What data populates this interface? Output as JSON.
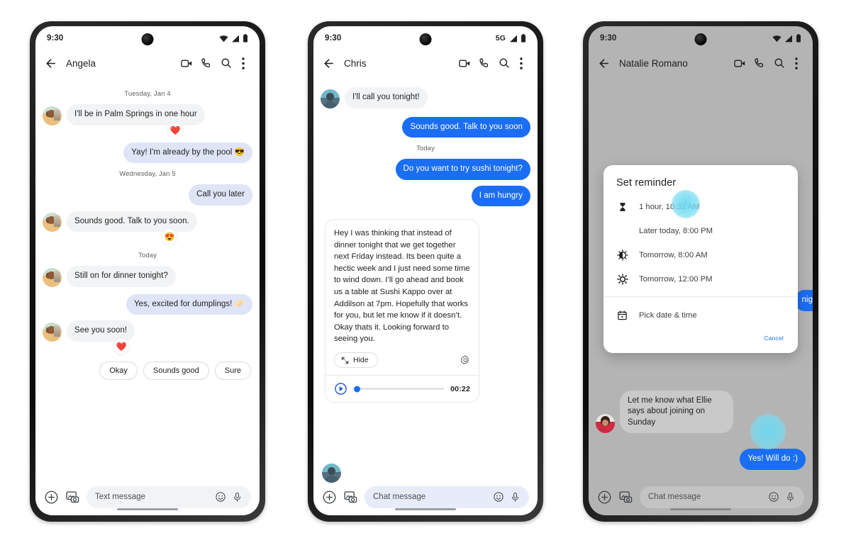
{
  "phones": [
    {
      "id": "phone-sms",
      "status": {
        "time": "9:30",
        "network": "",
        "icons": [
          "wifi-icon",
          "signal-icon",
          "battery-icon"
        ]
      },
      "appbar": {
        "back": "back-arrow-icon",
        "title": "Angela",
        "actions": [
          "video-call-icon",
          "phone-call-icon",
          "search-icon",
          "overflow-menu-icon"
        ]
      },
      "messages": [
        {
          "kind": "daystamp",
          "text": "Tuesday, Jan 4"
        },
        {
          "kind": "in",
          "text": "I'll be in Palm Springs in one hour",
          "avatar": "av-a",
          "reaction": "❤️"
        },
        {
          "kind": "out",
          "text": "Yay! I'm already by the pool 😎"
        },
        {
          "kind": "daystamp",
          "text": "Wednesday, Jan 5"
        },
        {
          "kind": "out",
          "text": "Call you later"
        },
        {
          "kind": "in",
          "text": "Sounds good. Talk to you soon.",
          "avatar": "av-a",
          "reaction": "😍"
        },
        {
          "kind": "daystamp",
          "text": "Today"
        },
        {
          "kind": "in",
          "text": "Still on for dinner tonight?",
          "avatar": "av-a"
        },
        {
          "kind": "out",
          "text": "Yes, excited for dumplings! 🥟"
        },
        {
          "kind": "in",
          "text": "See you soon!",
          "avatar": "av-a",
          "reaction": "❤️"
        }
      ],
      "chips": [
        "Okay",
        "Sounds good",
        "Sure"
      ],
      "composer": {
        "plus": "add-icon",
        "gallery": "gallery-camera-icon",
        "placeholder": "Text message",
        "emoji": "emoji-icon",
        "mic": "microphone-icon"
      }
    },
    {
      "id": "phone-rcs",
      "status": {
        "time": "9:30",
        "network": "5G",
        "icons": [
          "signal-icon",
          "battery-icon"
        ]
      },
      "appbar": {
        "back": "back-arrow-icon",
        "title": "Chris",
        "actions": [
          "video-call-icon",
          "phone-call-icon",
          "search-icon",
          "overflow-menu-icon"
        ]
      },
      "messages": [
        {
          "kind": "in",
          "text": "I'll call you tonight!",
          "avatar": "av-b"
        },
        {
          "kind": "out-blue",
          "text": "Sounds good. Talk to you soon"
        },
        {
          "kind": "daystamp",
          "text": "Today"
        },
        {
          "kind": "out-blue",
          "text": "Do you want to try sushi tonight?"
        },
        {
          "kind": "out-blue",
          "text": "I am hungry"
        }
      ],
      "long_message": {
        "text": "Hey I was thinking that instead of dinner tonight that we get together next Friday instead. Its been quite a hectic week and I just need some time to wind down.  I’ll go ahead and book us a table at Sushi Kappo over at Addilson at 7pm.  Hopefully that works for you, but let me know if it doesn’t. Okay thats it. Looking forward to seeing you.",
        "hide_label": "Hide",
        "hide_icon": "collapse-icon",
        "settings_icon": "gear-icon"
      },
      "audio": {
        "play_icon": "play-icon",
        "duration": "00:22",
        "progress": 0,
        "avatar": "av-b"
      },
      "composer": {
        "plus": "add-icon",
        "gallery": "gallery-camera-icon",
        "placeholder": "Chat message",
        "emoji": "emoji-icon",
        "mic": "microphone-icon"
      }
    },
    {
      "id": "phone-reminder",
      "status": {
        "time": "9:30",
        "network": "",
        "icons": [
          "wifi-icon",
          "signal-icon",
          "battery-icon"
        ]
      },
      "appbar": {
        "back": "back-arrow-icon",
        "title": "Natalie Romano",
        "actions": [
          "video-call-icon",
          "phone-call-icon",
          "search-icon",
          "overflow-menu-icon"
        ]
      },
      "messages": [
        {
          "kind": "out-blue-clipped",
          "text": "night!"
        },
        {
          "kind": "in",
          "text": "Let me know what Ellie says about joining on Sunday",
          "avatar": "av-c"
        },
        {
          "kind": "out-blue",
          "text": "Yes! Will do :)"
        }
      ],
      "dialog": {
        "title": "Set reminder",
        "options": [
          {
            "icon": "hourglass-icon",
            "label": "1 hour, 10:32 AM",
            "selected": true
          },
          {
            "icon": "moon-icon",
            "label": "Later today, 8:00 PM",
            "selected": false
          },
          {
            "icon": "half-sun-icon",
            "label": "Tomorrow, 8:00 AM",
            "selected": false
          },
          {
            "icon": "sun-icon",
            "label": "Tomorrow, 12:00 PM",
            "selected": false
          }
        ],
        "pick": {
          "icon": "calendar-icon",
          "label": "Pick date & time"
        },
        "cancel_label": "Cancel"
      },
      "composer": {
        "plus": "add-icon",
        "gallery": "gallery-camera-icon",
        "placeholder": "Chat message",
        "emoji": "emoji-icon",
        "mic": "microphone-icon"
      }
    }
  ],
  "colors": {
    "sent_sms": "#dfe5f7",
    "sent_rcs": "#1b6ef3",
    "received": "#f1f3f4",
    "accent": "#1b6ef3",
    "touch_indicator": "#6cd8f0",
    "dim_overlay": "#b4b4b4"
  }
}
